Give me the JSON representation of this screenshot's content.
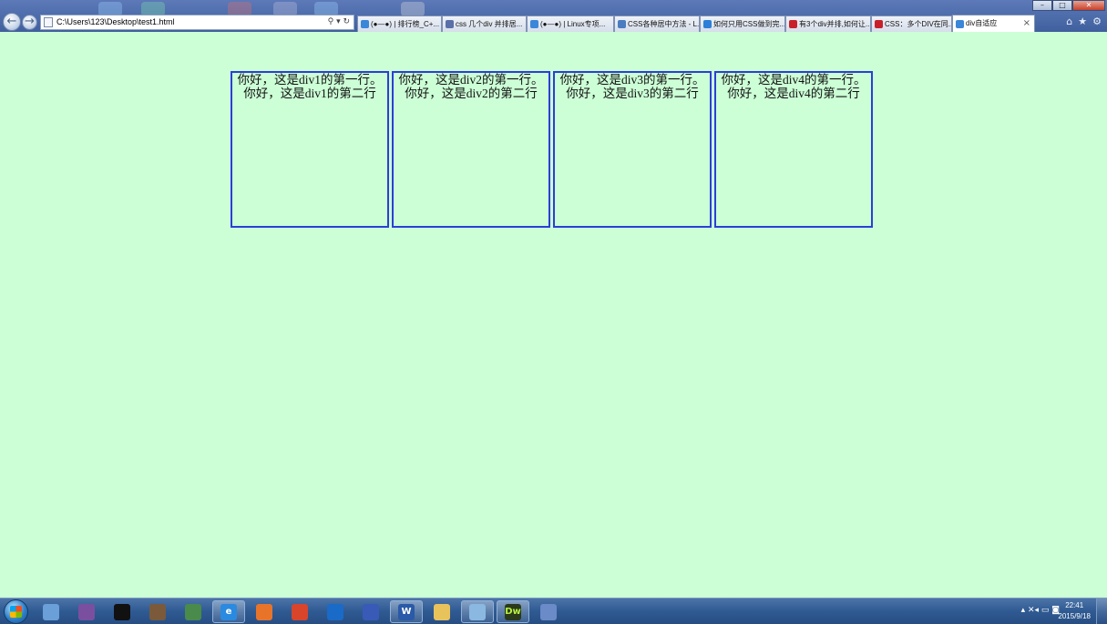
{
  "browser": {
    "address": "C:\\Users\\123\\Desktop\\test1.html",
    "addr_tools": "⚲ ▾ ↻",
    "back_icon": "back-arrow-icon",
    "forward_icon": "forward-arrow-icon",
    "tabs": [
      {
        "label": "(●—●) | 排行榜_C+...",
        "color": "#3a86d8",
        "active": false
      },
      {
        "label": "css 几个div 并排居...",
        "color": "#5b6fa8",
        "active": false
      },
      {
        "label": "(●—●) | Linux专项...",
        "color": "#3a86d8",
        "active": false
      },
      {
        "label": "CSS各种居中方法 - L...",
        "color": "#4a7cc0",
        "active": false
      },
      {
        "label": "如何只用CSS做到完...",
        "color": "#2d7fd8",
        "active": false
      },
      {
        "label": "有3个div并排,如何让...",
        "color": "#c8202a",
        "active": false
      },
      {
        "label": "CSS：多个DIV在同...",
        "color": "#c8202a",
        "active": false
      },
      {
        "label": "div自适应",
        "color": "#3a86d8",
        "active": true
      }
    ],
    "tab_close": "×",
    "window_buttons": {
      "minimize": "–",
      "maximize": "□",
      "close": "✕"
    },
    "toolbar_icons": {
      "home": "⌂",
      "favorites": "★",
      "settings": "⚙"
    }
  },
  "page": {
    "divs": [
      {
        "line1": "你好，这是div1的第一行。",
        "line2": "你好，这是div1的第二行"
      },
      {
        "line1": "你好，这是div2的第一行。",
        "line2": "你好，这是div2的第二行"
      },
      {
        "line1": "你好，这是div3的第一行。",
        "line2": "你好，这是div3的第二行"
      },
      {
        "line1": "你好，这是div4的第一行。",
        "line2": "你好，这是div4的第二行"
      }
    ],
    "background_color": "#ccffd6",
    "border_color": "#2b3fd8"
  },
  "taskbar": {
    "apps": [
      {
        "name": "file-document-icon",
        "color": "#6a9fd8",
        "glyph": "",
        "open": false
      },
      {
        "name": "calculator-icon",
        "color": "#7a4fa0",
        "glyph": "",
        "open": false
      },
      {
        "name": "qq-penguin-icon",
        "color": "#111111",
        "glyph": "",
        "open": false
      },
      {
        "name": "book-icon",
        "color": "#7a5a3a",
        "glyph": "",
        "open": false
      },
      {
        "name": "spreadsheet-icon",
        "color": "#4a8a4a",
        "glyph": "",
        "open": false
      },
      {
        "name": "internet-explorer-icon",
        "color": "#2a8ae0",
        "glyph": "e",
        "open": true
      },
      {
        "name": "firefox-icon",
        "color": "#e8742a",
        "glyph": "",
        "open": false
      },
      {
        "name": "chrome-icon",
        "color": "#d8452a",
        "glyph": "",
        "open": false
      },
      {
        "name": "teamviewer-icon",
        "color": "#1a6ac8",
        "glyph": "",
        "open": false
      },
      {
        "name": "glasses-icon",
        "color": "#3a5ab8",
        "glyph": "",
        "open": false
      },
      {
        "name": "word-icon",
        "color": "#2a5aa8",
        "glyph": "W",
        "open": true
      },
      {
        "name": "folder-icon",
        "color": "#e8c25a",
        "glyph": "",
        "open": false
      },
      {
        "name": "image-viewer-icon",
        "color": "#8ab8e0",
        "glyph": "",
        "open": true
      },
      {
        "name": "dreamweaver-icon",
        "color": "#2a3a1a",
        "glyph": "Dw",
        "open": true
      },
      {
        "name": "pen-icon",
        "color": "#6a8ac8",
        "glyph": "",
        "open": false
      }
    ],
    "tray_icons": "▴  ✕◂  ▭  ◙",
    "time": "22:41",
    "date": "2015/9/18"
  }
}
